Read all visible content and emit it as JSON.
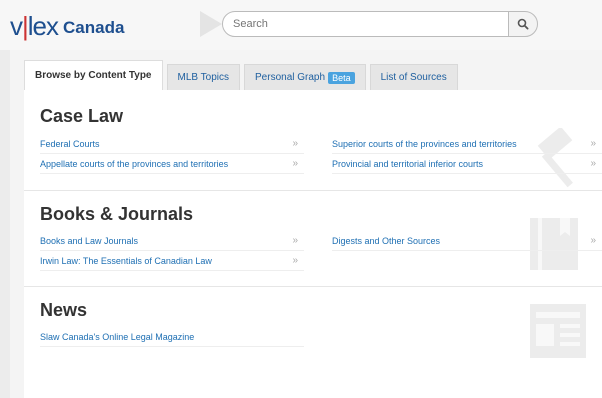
{
  "logo": {
    "mark_left": "v",
    "mark_sep": "|",
    "mark_right": "lex",
    "text": "Canada"
  },
  "search": {
    "placeholder": "Search"
  },
  "tabs": [
    {
      "label": "Browse by Content Type",
      "active": true
    },
    {
      "label": "MLB Topics"
    },
    {
      "label": "Personal Graph",
      "badge": "Beta"
    },
    {
      "label": "List of Sources"
    }
  ],
  "sections": {
    "case_law": {
      "title": "Case Law",
      "left": [
        "Federal Courts",
        "Appellate courts of the provinces and territories"
      ],
      "right": [
        "Superior courts of the provinces and territories",
        "Provincial and territorial inferior courts"
      ]
    },
    "books": {
      "title": "Books & Journals",
      "left": [
        "Books and Law Journals",
        "Irwin Law: The Essentials of Canadian Law"
      ],
      "right": [
        "Digests and Other Sources"
      ]
    },
    "news": {
      "title": "News",
      "left": [
        "Slaw Canada's Online Legal Magazine"
      ]
    }
  },
  "chevron": "»",
  "colors": {
    "brand": "#1e4f8f",
    "link": "#1e6fb3",
    "badge": "#4aa3df"
  }
}
